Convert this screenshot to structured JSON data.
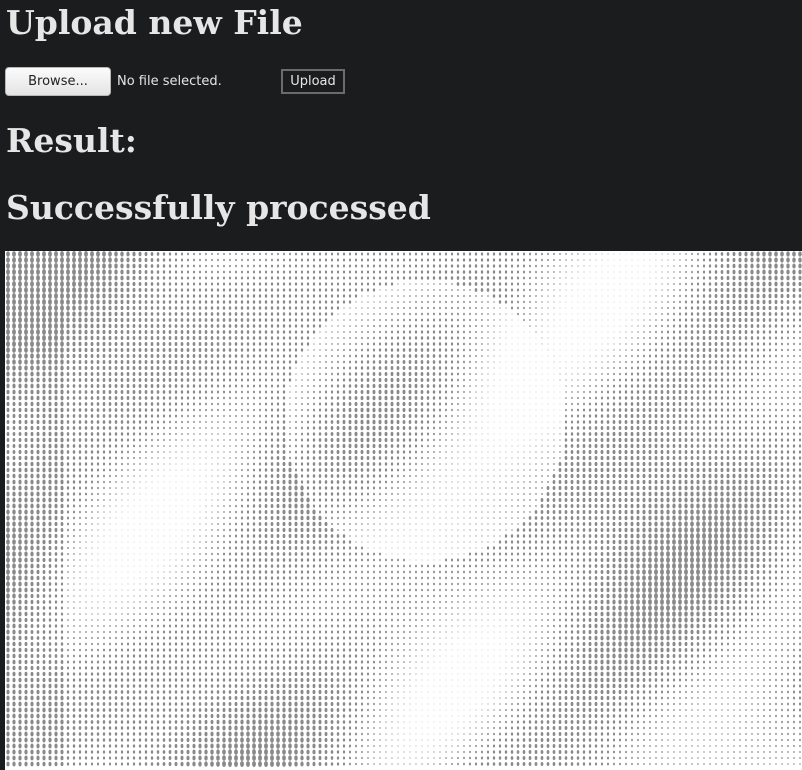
{
  "page": {
    "title": "Upload new File",
    "result_heading": "Result:",
    "status_message": "Successfully processed"
  },
  "upload_form": {
    "browse_label": "Browse...",
    "file_status": "No file selected.",
    "upload_label": "Upload"
  },
  "result_image": {
    "description_icon": "halftone-dot-pattern-image",
    "background_color": "#ffffff",
    "dot_color": "#8a8a8a"
  }
}
